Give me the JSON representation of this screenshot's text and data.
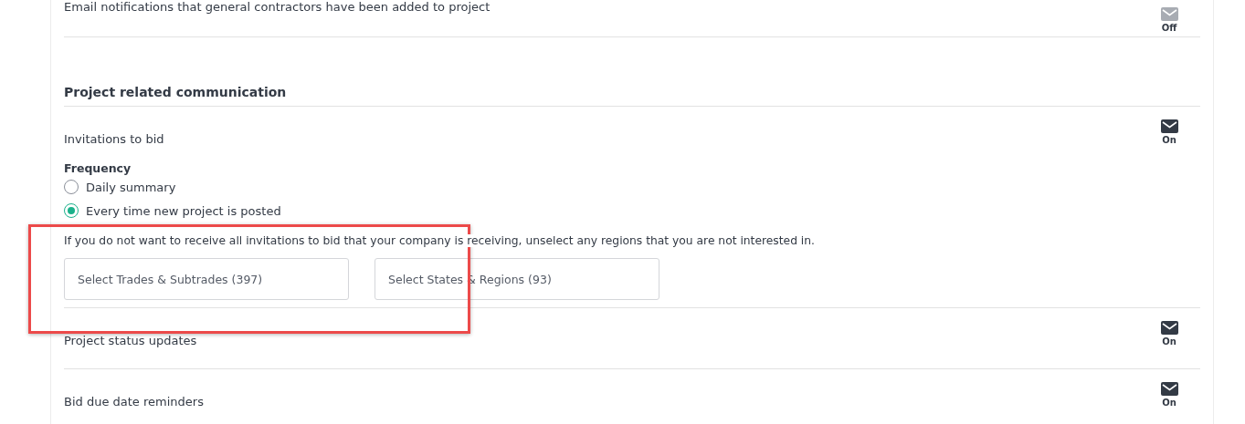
{
  "top_setting": {
    "label": "Email notifications that general contractors have been added to project",
    "on": false,
    "status": "Off"
  },
  "section": {
    "title": "Project related communication",
    "settings": [
      {
        "kind": "frequency",
        "label": "Invitations to bid",
        "on": true,
        "status": "On",
        "frequency_label": "Frequency",
        "options": [
          {
            "label": "Daily summary",
            "selected": false
          },
          {
            "label": "Every time new project is posted",
            "selected": true
          }
        ],
        "note": "If you do not want to receive all invitations to bid that your company is receiving, unselect any regions that you are not interested in.",
        "fields": [
          {
            "placeholder": "Select Trades & Subtrades (397)"
          },
          {
            "placeholder": "Select States & Regions (93)"
          }
        ]
      },
      {
        "kind": "simple",
        "label": "Project status updates",
        "on": true,
        "status": "On"
      },
      {
        "kind": "simple",
        "label": "Bid due date reminders",
        "on": true,
        "status": "On"
      }
    ]
  }
}
